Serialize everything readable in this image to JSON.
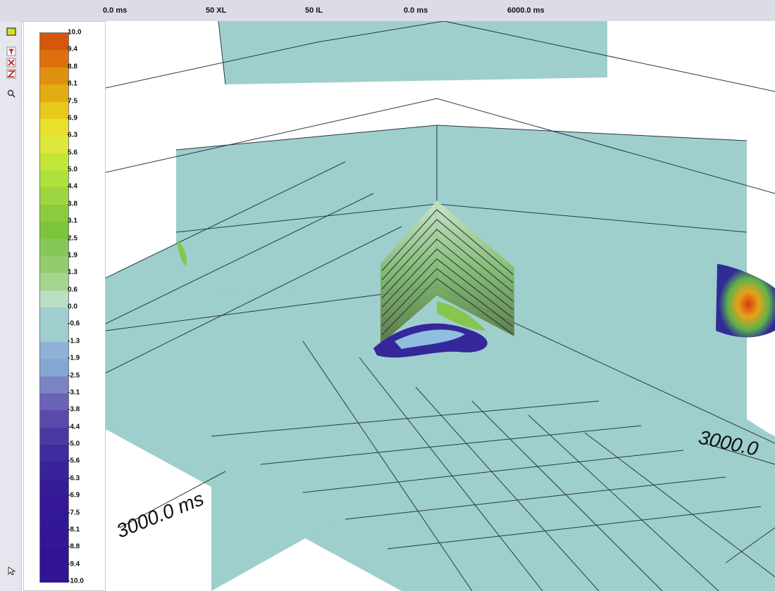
{
  "header": {
    "items": [
      "0.0 ms",
      "50 XL",
      "50 IL",
      "0.0 ms",
      "6000.0 ms"
    ]
  },
  "toolbar": {
    "icons": [
      "palette-icon",
      "axis-y-icon",
      "axis-x-icon",
      "axis-z-icon",
      "zoom-icon",
      "pointer-icon"
    ]
  },
  "colorbar": {
    "ticks": [
      "10.0",
      "9.4",
      "8.8",
      "8.1",
      "7.5",
      "6.9",
      "6.3",
      "5.6",
      "5.0",
      "4.4",
      "3.8",
      "3.1",
      "2.5",
      "1.9",
      "1.3",
      "0.6",
      "0.0",
      "-0.6",
      "-1.3",
      "-1.9",
      "-2.5",
      "-3.1",
      "-3.8",
      "-4.4",
      "-5.0",
      "-5.6",
      "-6.3",
      "-6.9",
      "-7.5",
      "-8.1",
      "-8.8",
      "-9.4",
      "-10.0"
    ],
    "colors": [
      "#d6560b",
      "#dd700c",
      "#df9010",
      "#e2ad12",
      "#e9c81c",
      "#eadf2c",
      "#dce93c",
      "#c3e636",
      "#aee13c",
      "#9fd640",
      "#8ccc3c",
      "#7cc43c",
      "#86c858",
      "#93cc6e",
      "#a4d690",
      "#bcdec4",
      "#9ecfce",
      "#9ecfce",
      "#8eb2d6",
      "#86a6d2",
      "#7a84c4",
      "#6a62b6",
      "#5c4aaa",
      "#4c38a2",
      "#3e2c9c",
      "#3a229a",
      "#361c98",
      "#341898",
      "#321896",
      "#321696",
      "#301494",
      "#301494"
    ]
  },
  "scene": {
    "axis_labels": [
      "3000.0 ms",
      "3000.0"
    ],
    "colors": {
      "slice": "#9ecfcc",
      "grid": "#2a3548",
      "background": "#ffffff"
    }
  }
}
